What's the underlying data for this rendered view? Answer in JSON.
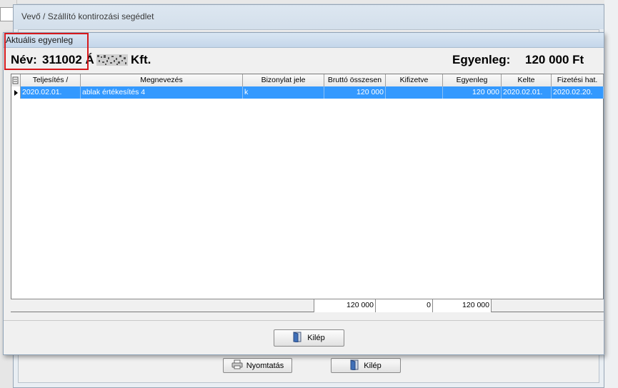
{
  "outer_dialog": {
    "title": "Vevő / Szállító kontirozási segédlet",
    "print_button": "Nyomtatás",
    "exit_button": "Kilép"
  },
  "inner_dialog": {
    "title": "Aktuális egyenleg",
    "name_label": "Név:",
    "name_code": "311002 Á",
    "name_suffix": "Kft.",
    "balance_label": "Egyenleg:",
    "balance_value": "120 000 Ft",
    "exit_button": "Kilép"
  },
  "grid": {
    "columns": [
      "Teljesítés /",
      "Megnevezés",
      "Bizonylat jele",
      "Bruttó összesen",
      "Kifizetve",
      "Egyenleg",
      "Kelte",
      "Fizetési hat."
    ],
    "rows": [
      [
        "2020.02.01.",
        "ablak értékesítés 4",
        "k",
        "120 000",
        "",
        "120 000",
        "2020.02.01.",
        "2020.02.20."
      ]
    ],
    "totals": {
      "brutto": "120 000",
      "kifizetve": "0",
      "egyenleg": "120 000"
    }
  },
  "colors": {
    "selection": "#3399ff",
    "highlight_border": "#d6191c"
  }
}
